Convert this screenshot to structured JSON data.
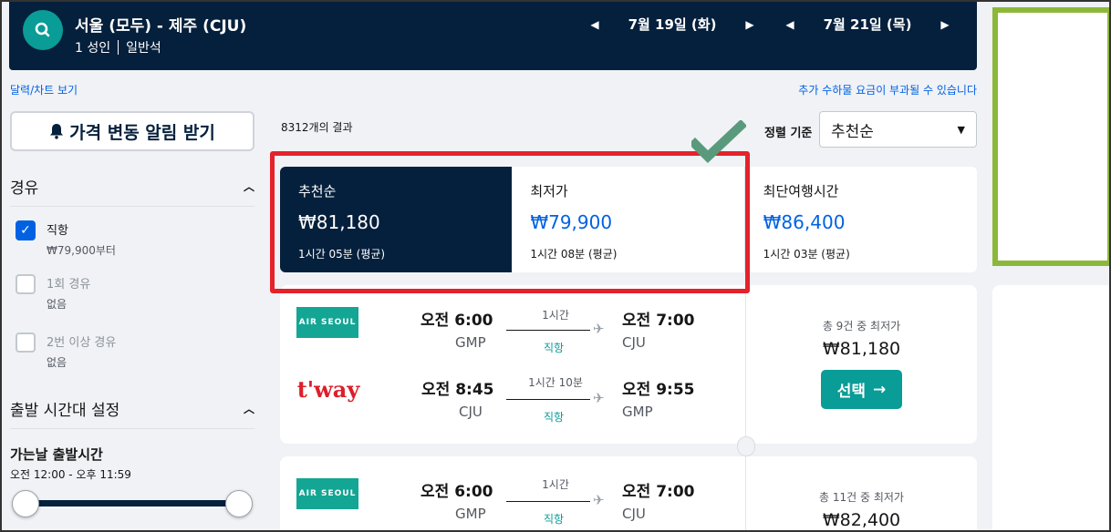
{
  "header": {
    "route": "서울 (모두) - 제주 (CJU)",
    "passengers": "1 성인",
    "cabin": "일반석",
    "depart_date": "7월 19일 (화)",
    "return_date": "7월 21일 (목)"
  },
  "links": {
    "calendar": "달력/차트 보기",
    "baggage_note": "추가 수하물 요금이 부과될 수 있습니다"
  },
  "sidebar": {
    "alert_button": "가격 변동 알림 받기",
    "stops_title": "경유",
    "stops": [
      {
        "label": "직항",
        "sub": "₩79,900부터",
        "checked": true
      },
      {
        "label": "1회 경유",
        "sub": "없음",
        "checked": false
      },
      {
        "label": "2번 이상 경유",
        "sub": "없음",
        "checked": false
      }
    ],
    "time_title": "출발 시간대 설정",
    "outbound_title": "가는날 출발시간",
    "outbound_range": "오전 12:00 - 오후 11:59"
  },
  "results": {
    "count": "8312개의 결과",
    "sort_label": "정렬 기준",
    "sort_value": "추천순"
  },
  "sort_tabs": [
    {
      "title": "추천순",
      "price": "₩81,180",
      "duration": "1시간 05분 (평균)",
      "active": true
    },
    {
      "title": "최저가",
      "price": "₩79,900",
      "duration": "1시간 08분 (평균)",
      "active": false
    },
    {
      "title": "최단여행시간",
      "price": "₩86,400",
      "duration": "1시간 03분 (평균)",
      "active": false
    }
  ],
  "cards": [
    {
      "legs": [
        {
          "airline": "AIR SEOUL",
          "dep_time": "오전 6:00",
          "dep_apt": "GMP",
          "duration": "1시간",
          "stops": "직항",
          "arr_time": "오전 7:00",
          "arr_apt": "CJU"
        },
        {
          "airline": "t'way",
          "dep_time": "오전 8:45",
          "dep_apt": "CJU",
          "duration": "1시간 10분",
          "stops": "직항",
          "arr_time": "오전 9:55",
          "arr_apt": "GMP"
        }
      ],
      "offers": "총 9건 중 최저가",
      "price": "₩81,180",
      "select_label": "선택"
    },
    {
      "legs": [
        {
          "airline": "AIR SEOUL",
          "dep_time": "오전 6:00",
          "dep_apt": "GMP",
          "duration": "1시간",
          "stops": "직항",
          "arr_time": "오전 7:00",
          "arr_apt": "CJU"
        }
      ],
      "offers": "총 11건 중 최저가",
      "price": "₩82,400"
    }
  ],
  "colors": {
    "navy": "#05203c",
    "teal": "#0a9c97",
    "link_blue": "#0062e3",
    "highlight_red": "#e4222b",
    "check_green": "#5a9a7c",
    "ad_border": "#8cb83a"
  }
}
